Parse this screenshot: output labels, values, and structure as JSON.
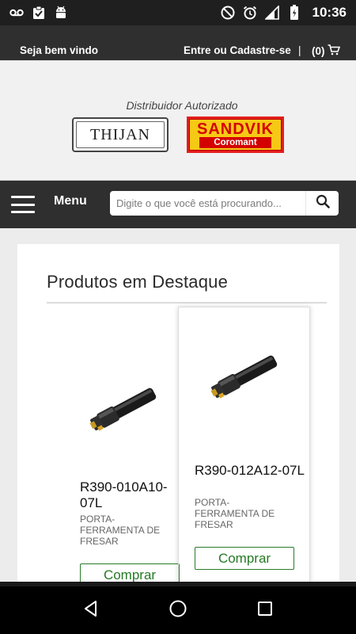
{
  "status_bar": {
    "time": "10:36",
    "left_icons": [
      "voicemail-icon",
      "clipboard-icon",
      "android-icon"
    ],
    "right_icons": [
      "no-disturb-icon",
      "alarm-icon",
      "signal-icon",
      "battery-icon"
    ]
  },
  "top_bar": {
    "welcome": "Seja bem vindo",
    "login": "Entre ou Cadastre-se",
    "separator": "|",
    "cart_count": "(0)"
  },
  "logo": {
    "distributor_text": "Distribuidor Autorizado",
    "thijan": "THIJAN",
    "sandvik_brand": "SANDVIK",
    "sandvik_sub": "Coromant"
  },
  "menu": {
    "label": "Menu",
    "search_placeholder": "Digite o que você está procurando..."
  },
  "featured": {
    "title": "Produtos em Destaque",
    "products": [
      {
        "name": "R390-010A10-07L",
        "description": "PORTA-FERRAMENTA DE FRESAR",
        "buy_label": "Comprar"
      },
      {
        "name": "R390-012A12-07L",
        "description": "PORTA-FERRAMENTA DE FRESAR",
        "buy_label": "Comprar"
      }
    ]
  },
  "colors": {
    "dark_bar": "#2f2f2f",
    "buy_green": "#257a25",
    "sandvik_red": "#e41e1e",
    "sandvik_yellow": "#f6c915"
  }
}
